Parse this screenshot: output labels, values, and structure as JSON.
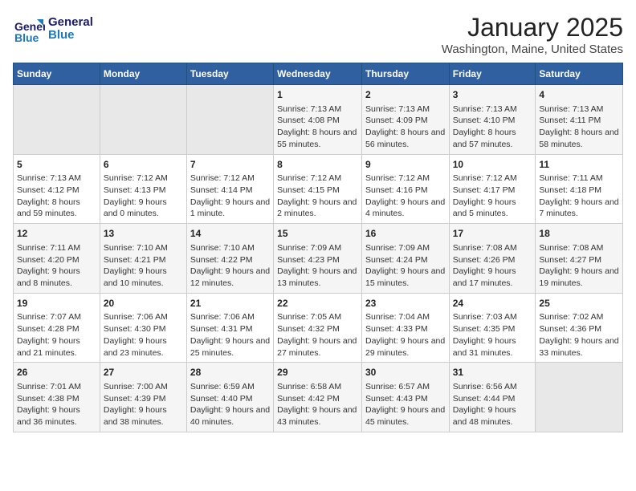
{
  "logo": {
    "line1": "General",
    "line2": "Blue"
  },
  "title": "January 2025",
  "subtitle": "Washington, Maine, United States",
  "days_of_week": [
    "Sunday",
    "Monday",
    "Tuesday",
    "Wednesday",
    "Thursday",
    "Friday",
    "Saturday"
  ],
  "weeks": [
    [
      {
        "day": "",
        "info": ""
      },
      {
        "day": "",
        "info": ""
      },
      {
        "day": "",
        "info": ""
      },
      {
        "day": "1",
        "info": "Sunrise: 7:13 AM\nSunset: 4:08 PM\nDaylight: 8 hours and 55 minutes."
      },
      {
        "day": "2",
        "info": "Sunrise: 7:13 AM\nSunset: 4:09 PM\nDaylight: 8 hours and 56 minutes."
      },
      {
        "day": "3",
        "info": "Sunrise: 7:13 AM\nSunset: 4:10 PM\nDaylight: 8 hours and 57 minutes."
      },
      {
        "day": "4",
        "info": "Sunrise: 7:13 AM\nSunset: 4:11 PM\nDaylight: 8 hours and 58 minutes."
      }
    ],
    [
      {
        "day": "5",
        "info": "Sunrise: 7:13 AM\nSunset: 4:12 PM\nDaylight: 8 hours and 59 minutes."
      },
      {
        "day": "6",
        "info": "Sunrise: 7:12 AM\nSunset: 4:13 PM\nDaylight: 9 hours and 0 minutes."
      },
      {
        "day": "7",
        "info": "Sunrise: 7:12 AM\nSunset: 4:14 PM\nDaylight: 9 hours and 1 minute."
      },
      {
        "day": "8",
        "info": "Sunrise: 7:12 AM\nSunset: 4:15 PM\nDaylight: 9 hours and 2 minutes."
      },
      {
        "day": "9",
        "info": "Sunrise: 7:12 AM\nSunset: 4:16 PM\nDaylight: 9 hours and 4 minutes."
      },
      {
        "day": "10",
        "info": "Sunrise: 7:12 AM\nSunset: 4:17 PM\nDaylight: 9 hours and 5 minutes."
      },
      {
        "day": "11",
        "info": "Sunrise: 7:11 AM\nSunset: 4:18 PM\nDaylight: 9 hours and 7 minutes."
      }
    ],
    [
      {
        "day": "12",
        "info": "Sunrise: 7:11 AM\nSunset: 4:20 PM\nDaylight: 9 hours and 8 minutes."
      },
      {
        "day": "13",
        "info": "Sunrise: 7:10 AM\nSunset: 4:21 PM\nDaylight: 9 hours and 10 minutes."
      },
      {
        "day": "14",
        "info": "Sunrise: 7:10 AM\nSunset: 4:22 PM\nDaylight: 9 hours and 12 minutes."
      },
      {
        "day": "15",
        "info": "Sunrise: 7:09 AM\nSunset: 4:23 PM\nDaylight: 9 hours and 13 minutes."
      },
      {
        "day": "16",
        "info": "Sunrise: 7:09 AM\nSunset: 4:24 PM\nDaylight: 9 hours and 15 minutes."
      },
      {
        "day": "17",
        "info": "Sunrise: 7:08 AM\nSunset: 4:26 PM\nDaylight: 9 hours and 17 minutes."
      },
      {
        "day": "18",
        "info": "Sunrise: 7:08 AM\nSunset: 4:27 PM\nDaylight: 9 hours and 19 minutes."
      }
    ],
    [
      {
        "day": "19",
        "info": "Sunrise: 7:07 AM\nSunset: 4:28 PM\nDaylight: 9 hours and 21 minutes."
      },
      {
        "day": "20",
        "info": "Sunrise: 7:06 AM\nSunset: 4:30 PM\nDaylight: 9 hours and 23 minutes."
      },
      {
        "day": "21",
        "info": "Sunrise: 7:06 AM\nSunset: 4:31 PM\nDaylight: 9 hours and 25 minutes."
      },
      {
        "day": "22",
        "info": "Sunrise: 7:05 AM\nSunset: 4:32 PM\nDaylight: 9 hours and 27 minutes."
      },
      {
        "day": "23",
        "info": "Sunrise: 7:04 AM\nSunset: 4:33 PM\nDaylight: 9 hours and 29 minutes."
      },
      {
        "day": "24",
        "info": "Sunrise: 7:03 AM\nSunset: 4:35 PM\nDaylight: 9 hours and 31 minutes."
      },
      {
        "day": "25",
        "info": "Sunrise: 7:02 AM\nSunset: 4:36 PM\nDaylight: 9 hours and 33 minutes."
      }
    ],
    [
      {
        "day": "26",
        "info": "Sunrise: 7:01 AM\nSunset: 4:38 PM\nDaylight: 9 hours and 36 minutes."
      },
      {
        "day": "27",
        "info": "Sunrise: 7:00 AM\nSunset: 4:39 PM\nDaylight: 9 hours and 38 minutes."
      },
      {
        "day": "28",
        "info": "Sunrise: 6:59 AM\nSunset: 4:40 PM\nDaylight: 9 hours and 40 minutes."
      },
      {
        "day": "29",
        "info": "Sunrise: 6:58 AM\nSunset: 4:42 PM\nDaylight: 9 hours and 43 minutes."
      },
      {
        "day": "30",
        "info": "Sunrise: 6:57 AM\nSunset: 4:43 PM\nDaylight: 9 hours and 45 minutes."
      },
      {
        "day": "31",
        "info": "Sunrise: 6:56 AM\nSunset: 4:44 PM\nDaylight: 9 hours and 48 minutes."
      },
      {
        "day": "",
        "info": ""
      }
    ]
  ]
}
